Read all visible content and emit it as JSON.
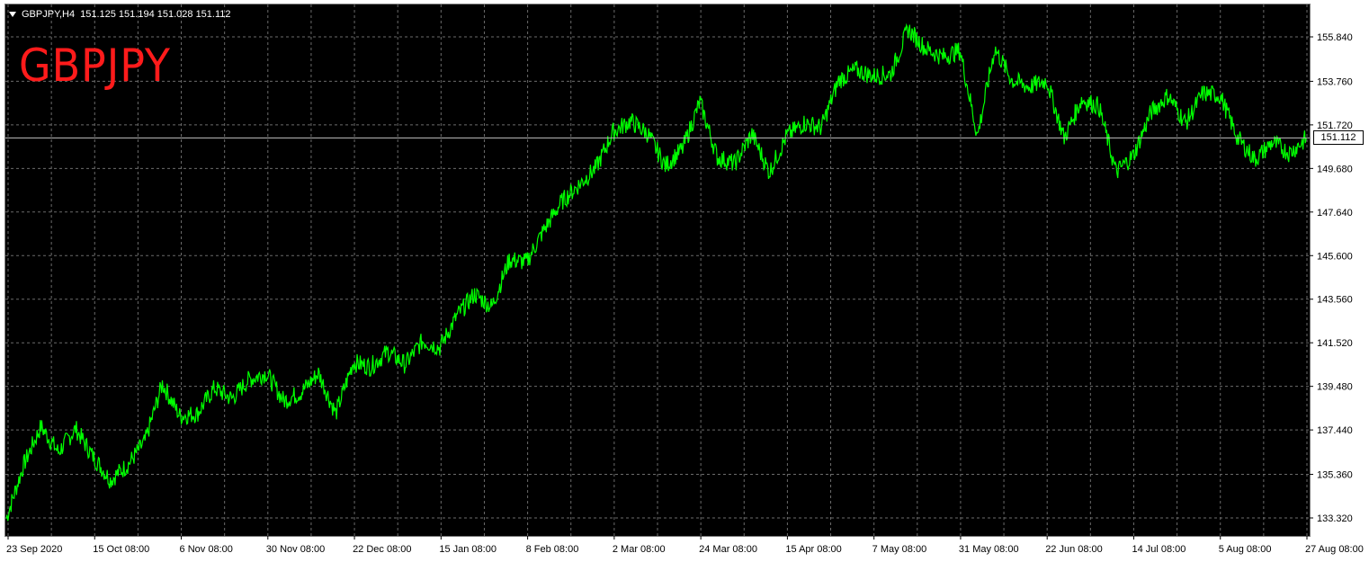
{
  "header": {
    "symbol_timeframe": "GBPJPY,H4",
    "ohlc": "151.125 151.194 151.028 151.112",
    "dropdown_icon": "triangle-down-icon"
  },
  "watermark": {
    "symbol": "GBPJPY",
    "color": "#ff1b1b"
  },
  "current_price": "151.112",
  "colors": {
    "background": "#000000",
    "line": "#00ff00",
    "grid": "#6b6b6b",
    "axis_text": "#000000"
  },
  "chart_data": {
    "type": "line",
    "title": "",
    "xlabel": "",
    "ylabel": "",
    "ylim": [
      132.6,
      157.0
    ],
    "grid": true,
    "y_ticks": [
      "155.840",
      "153.760",
      "151.720",
      "149.680",
      "147.640",
      "145.600",
      "143.560",
      "141.520",
      "139.480",
      "137.440",
      "135.360",
      "133.320"
    ],
    "x_ticks": [
      "23 Sep 2020",
      "15 Oct 08:00",
      "6 Nov 08:00",
      "30 Nov 08:00",
      "22 Dec 08:00",
      "15 Jan 08:00",
      "8 Feb 08:00",
      "2 Mar 08:00",
      "24 Mar 08:00",
      "15 Apr 08:00",
      "7 May 08:00",
      "31 May 08:00",
      "22 Jun 08:00",
      "14 Jul 08:00",
      "5 Aug 08:00",
      "27 Aug 08:00"
    ],
    "series": [
      {
        "x": [
          "23 Sep 2020",
          "1 Oct",
          "8 Oct",
          "12 Oct",
          "15 Oct 08:00",
          "20 Oct",
          "27 Oct",
          "1 Nov",
          "4 Nov",
          "6 Nov 08:00",
          "10 Nov",
          "14 Nov",
          "18 Nov",
          "22 Nov",
          "26 Nov",
          "30 Nov 08:00",
          "4 Dec",
          "8 Dec",
          "12 Dec",
          "16 Dec",
          "22 Dec 08:00",
          "26 Dec",
          "30 Dec",
          "4 Jan",
          "10 Jan",
          "15 Jan 08:00",
          "20 Jan",
          "25 Jan",
          "31 Jan",
          "4 Feb",
          "8 Feb 08:00",
          "12 Feb",
          "16 Feb",
          "20 Feb",
          "24 Feb",
          "2 Mar 08:00",
          "6 Mar",
          "10 Mar",
          "14 Mar",
          "19 Mar",
          "24 Mar 08:00",
          "28 Mar",
          "2 Apr",
          "6 Apr",
          "10 Apr",
          "15 Apr 08:00",
          "19 Apr",
          "23 Apr",
          "27 Apr",
          "1 May",
          "7 May 08:00",
          "11 May",
          "15 May",
          "20 May",
          "25 May",
          "31 May 08:00",
          "4 Jun",
          "8 Jun",
          "13 Jun",
          "17 Jun",
          "22 Jun 08:00",
          "26 Jun",
          "30 Jun",
          "5 Jul",
          "10 Jul",
          "14 Jul 08:00",
          "18 Jul",
          "23 Jul",
          "27 Jul",
          "1 Aug",
          "5 Aug 08:00",
          "9 Aug",
          "14 Aug",
          "19 Aug",
          "23 Aug",
          "27 Aug 08:00"
        ],
        "y": [
          133.3,
          135.8,
          137.6,
          136.4,
          137.5,
          136.2,
          135.1,
          135.8,
          136.9,
          139.6,
          138.1,
          138.2,
          139.4,
          138.9,
          139.8,
          140.1,
          138.8,
          139.2,
          140.1,
          138.2,
          140.6,
          140.4,
          141.1,
          140.5,
          141.6,
          141.3,
          142.8,
          143.8,
          143.2,
          145.4,
          145.3,
          146.8,
          148.1,
          148.9,
          149.7,
          151.4,
          151.9,
          151.3,
          149.8,
          150.6,
          152.8,
          150.2,
          149.9,
          151.3,
          149.5,
          151.2,
          151.8,
          151.6,
          153.8,
          154.3,
          154.0,
          154.1,
          156.2,
          155.3,
          154.9,
          155.2,
          151.2,
          155.3,
          153.8,
          153.5,
          153.8,
          151.1,
          152.9,
          152.6,
          149.5,
          150.3,
          152.3,
          153.1,
          151.8,
          153.2,
          153.1,
          151.1,
          150.1,
          150.9,
          150.4,
          151.11
        ]
      }
    ]
  }
}
